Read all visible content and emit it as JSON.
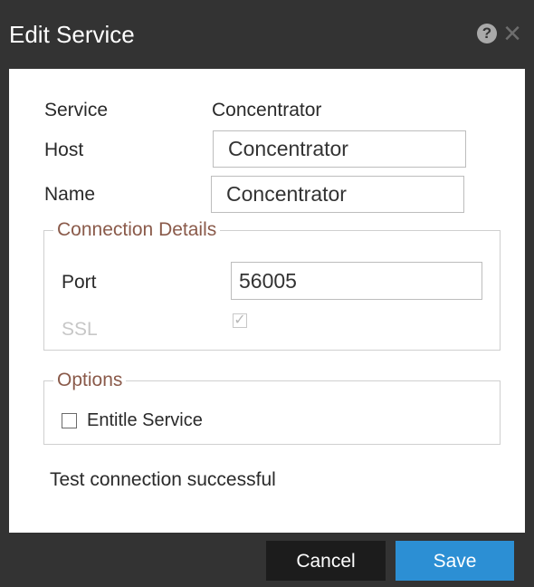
{
  "dialog": {
    "title": "Edit Service",
    "help_icon": "help-icon",
    "close_icon": "close-icon"
  },
  "form": {
    "service_label": "Service",
    "service_value": "Concentrator",
    "host_label": "Host",
    "host_value": "Concentrator",
    "name_label": "Name",
    "name_value": "Concentrator"
  },
  "connection_details": {
    "legend": "Connection Details",
    "port_label": "Port",
    "port_value": "56005",
    "ssl_label": "SSL",
    "ssl_checked": true
  },
  "options": {
    "legend": "Options",
    "entitle_service_label": "Entitle Service",
    "entitle_service_checked": false
  },
  "status": {
    "message": "Test connection successful"
  },
  "footer": {
    "cancel_label": "Cancel",
    "save_label": "Save"
  },
  "colors": {
    "frame": "#333333",
    "save_button": "#2c8fd4",
    "cancel_button": "#1c1c1c",
    "legend_text": "#8a5a4a"
  }
}
